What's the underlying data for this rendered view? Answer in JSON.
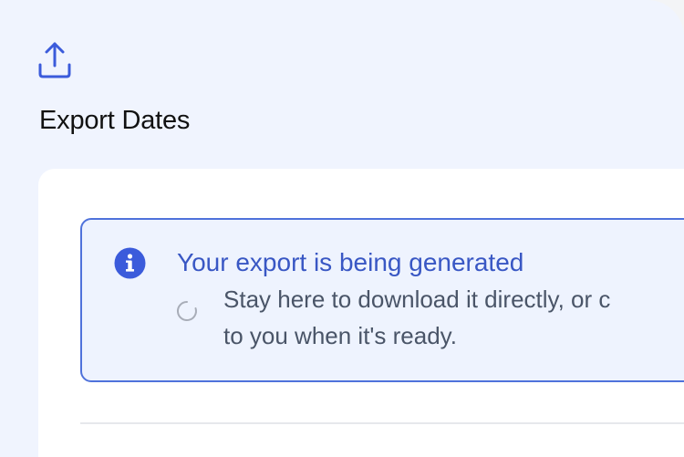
{
  "page": {
    "title": "Export Dates"
  },
  "icons": {
    "upload": "upload-icon",
    "info": "info-icon",
    "spinner": "loading-spinner-icon"
  },
  "alert": {
    "title": "Your export is being generated",
    "body_line_1": "Stay here to download it directly, or c",
    "body_line_2": "to you when it's ready."
  },
  "colors": {
    "accent": "#3b5bdb",
    "alert_background": "#eef3fe",
    "alert_border": "#4f72db",
    "page_background": "#f0f4fe"
  }
}
